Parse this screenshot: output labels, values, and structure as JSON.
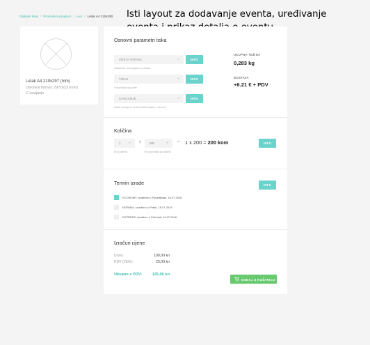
{
  "breadcrumb": {
    "items": [
      "Digitalni tisak",
      "Promotivni program",
      "Leci"
    ],
    "current": "Letak A4 210x290"
  },
  "annotation": "Isti layout za dodavanje eventa, uređivanje eventa i prikaz detalja o eventu",
  "product": {
    "name": "Letak A4 210x297 (mm)",
    "open_format": "Otvoreni format: 297x623 (mm)",
    "fold": "C savijanje"
  },
  "print_params": {
    "title": "Osnovni parametri tiska",
    "paper": {
      "value": "VRSTA PAPIRA",
      "hint": "Odaberite vrstu papira za otisak"
    },
    "print": {
      "value": "TISAK",
      "hint": "Vrsta tiska koju ćete"
    },
    "fold": {
      "value": "SAVIJANJE",
      "hint": "Način na koji će proizvod biti savijen u obrnut"
    },
    "info_label": "INFO",
    "weight_label": "UKUPNA TEŽINA",
    "weight_value": "0,283 kg",
    "delivery_label": "DOSTAVA",
    "delivery_value": "+6.21 € + PDV"
  },
  "quantity": {
    "title": "Količina",
    "packages_value": "1",
    "packages_hint": "Broj paketa",
    "per_package_value": "200",
    "per_package_hint": "Broj komada po paketu",
    "times": "x",
    "equals": "=",
    "formula_prefix": "1 x 200 = ",
    "formula_total": "200 kom",
    "info_label": "INFO"
  },
  "deadline": {
    "title": "Termin izrade",
    "info_label": "INFO",
    "options": [
      {
        "label": "ECONOMY: izrađeno u Ponedjeljak, 16.07.2016",
        "selected": true
      },
      {
        "label": "NORMAL: izrađeno u Petak, 15.07.2016",
        "selected": false
      },
      {
        "label": "EXPRESS: izrađeno u Četvrtak, 14.07.2016",
        "selected": false
      }
    ]
  },
  "pricing": {
    "title": "Izračun cijene",
    "amount_label": "Iznos:",
    "amount_value": "100,00 kn",
    "vat_label": "PDV (25%):",
    "vat_value": "25,00 kn",
    "total_label": "Ukupno s PDV:",
    "total_value": "125,00 kn",
    "add_to_cart": "DODAJ U KOŠARICU"
  },
  "colors": {
    "accent": "#3cbfb4",
    "info_button": "#6ad3cc",
    "cart_button": "#68c96f",
    "background": "#f4f4f4"
  }
}
